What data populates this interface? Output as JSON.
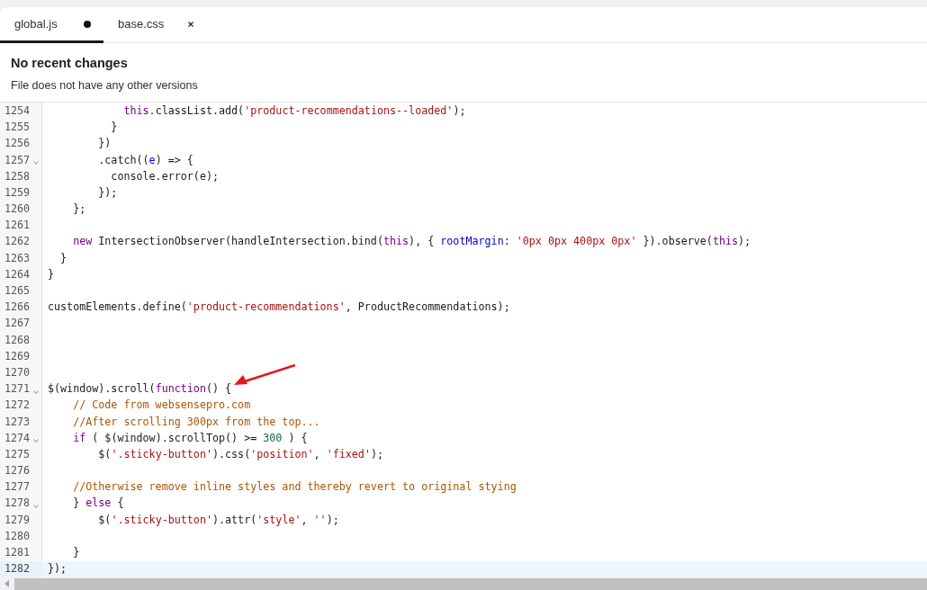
{
  "tabs": [
    {
      "label": "global.js",
      "selected": true,
      "modified": true
    },
    {
      "label": "base.css",
      "selected": false,
      "modified": false
    }
  ],
  "history": {
    "title": "No recent changes",
    "subtitle": "File does not have any other versions"
  },
  "editor": {
    "lines": [
      {
        "number": "1254",
        "fold": false,
        "active": false,
        "tokens": [
          {
            "t": "            this",
            "kind": "keyword"
          },
          {
            "t": ".classList.add(",
            "kind": "plain"
          },
          {
            "t": "'product-recommendations--loaded'",
            "kind": "string"
          },
          {
            "t": ");",
            "kind": "plain"
          }
        ]
      },
      {
        "number": "1255",
        "fold": false,
        "active": false,
        "tokens": [
          {
            "t": "          }",
            "kind": "plain"
          }
        ]
      },
      {
        "number": "1256",
        "fold": false,
        "active": false,
        "tokens": [
          {
            "t": "        })",
            "kind": "plain"
          }
        ]
      },
      {
        "number": "1257",
        "fold": true,
        "active": false,
        "tokens": [
          {
            "t": "        .catch((",
            "kind": "plain"
          },
          {
            "t": "e",
            "kind": "param"
          },
          {
            "t": ") => {",
            "kind": "plain"
          }
        ]
      },
      {
        "number": "1258",
        "fold": false,
        "active": false,
        "tokens": [
          {
            "t": "          console.error(e);",
            "kind": "plain"
          }
        ]
      },
      {
        "number": "1259",
        "fold": false,
        "active": false,
        "tokens": [
          {
            "t": "        });",
            "kind": "plain"
          }
        ]
      },
      {
        "number": "1260",
        "fold": false,
        "active": false,
        "tokens": [
          {
            "t": "    };",
            "kind": "plain"
          }
        ]
      },
      {
        "number": "1261",
        "fold": false,
        "active": false
      },
      {
        "number": "1262",
        "fold": false,
        "active": false,
        "tokens": [
          {
            "t": "    new",
            "kind": "keyword"
          },
          {
            "t": " IntersectionObserver(handleIntersection.bind(",
            "kind": "plain"
          },
          {
            "t": "this",
            "kind": "keyword"
          },
          {
            "t": "), { ",
            "kind": "plain"
          },
          {
            "t": "rootMargin",
            "kind": "property"
          },
          {
            "t": ": ",
            "kind": "plain"
          },
          {
            "t": "'0px 0px 400px 0px'",
            "kind": "string"
          },
          {
            "t": " }).observe(",
            "kind": "plain"
          },
          {
            "t": "this",
            "kind": "keyword"
          },
          {
            "t": ");",
            "kind": "plain"
          }
        ]
      },
      {
        "number": "1263",
        "fold": false,
        "active": false,
        "tokens": [
          {
            "t": "  }",
            "kind": "plain"
          }
        ]
      },
      {
        "number": "1264",
        "fold": false,
        "active": false,
        "tokens": [
          {
            "t": "}",
            "kind": "plain"
          }
        ]
      },
      {
        "number": "1265",
        "fold": false,
        "active": false
      },
      {
        "number": "1266",
        "fold": false,
        "active": false,
        "tokens": [
          {
            "t": "customElements.define(",
            "kind": "plain"
          },
          {
            "t": "'product-recommendations'",
            "kind": "string"
          },
          {
            "t": ", ProductRecommendations);",
            "kind": "plain"
          }
        ]
      },
      {
        "number": "1267",
        "fold": false,
        "active": false
      },
      {
        "number": "1268",
        "fold": false,
        "active": false
      },
      {
        "number": "1269",
        "fold": false,
        "active": false
      },
      {
        "number": "1270",
        "fold": false,
        "active": false
      },
      {
        "number": "1271",
        "fold": true,
        "active": false,
        "tokens": [
          {
            "t": "$(window).scroll(",
            "kind": "plain"
          },
          {
            "t": "function",
            "kind": "keyword"
          },
          {
            "t": "() {",
            "kind": "plain"
          }
        ]
      },
      {
        "number": "1272",
        "fold": false,
        "active": false,
        "tokens": [
          {
            "t": "    // Code from websensepro.com",
            "kind": "comment"
          }
        ]
      },
      {
        "number": "1273",
        "fold": false,
        "active": false,
        "tokens": [
          {
            "t": "    //After scrolling 300px from the top...",
            "kind": "comment"
          }
        ]
      },
      {
        "number": "1274",
        "fold": true,
        "active": false,
        "tokens": [
          {
            "t": "    if",
            "kind": "keyword"
          },
          {
            "t": " ( $(window).scrollTop() >= ",
            "kind": "plain"
          },
          {
            "t": "300",
            "kind": "number"
          },
          {
            "t": " ) {",
            "kind": "plain"
          }
        ]
      },
      {
        "number": "1275",
        "fold": false,
        "active": false,
        "tokens": [
          {
            "t": "        $(",
            "kind": "plain"
          },
          {
            "t": "'.sticky-button'",
            "kind": "string"
          },
          {
            "t": ").css(",
            "kind": "plain"
          },
          {
            "t": "'position'",
            "kind": "string"
          },
          {
            "t": ", ",
            "kind": "plain"
          },
          {
            "t": "'fixed'",
            "kind": "string"
          },
          {
            "t": ");",
            "kind": "plain"
          }
        ]
      },
      {
        "number": "1276",
        "fold": false,
        "active": false
      },
      {
        "number": "1277",
        "fold": false,
        "active": false,
        "tokens": [
          {
            "t": "    //Otherwise remove inline styles and thereby revert to original stying",
            "kind": "comment"
          }
        ]
      },
      {
        "number": "1278",
        "fold": true,
        "active": false,
        "tokens": [
          {
            "t": "    } ",
            "kind": "plain"
          },
          {
            "t": "else",
            "kind": "keyword"
          },
          {
            "t": " {",
            "kind": "plain"
          }
        ]
      },
      {
        "number": "1279",
        "fold": false,
        "active": false,
        "tokens": [
          {
            "t": "        $(",
            "kind": "plain"
          },
          {
            "t": "'.sticky-button'",
            "kind": "string"
          },
          {
            "t": ").attr(",
            "kind": "plain"
          },
          {
            "t": "'style'",
            "kind": "string"
          },
          {
            "t": ", ",
            "kind": "plain"
          },
          {
            "t": "''",
            "kind": "string"
          },
          {
            "t": ");",
            "kind": "plain"
          }
        ]
      },
      {
        "number": "1280",
        "fold": false,
        "active": false
      },
      {
        "number": "1281",
        "fold": false,
        "active": false,
        "tokens": [
          {
            "t": "    }",
            "kind": "plain"
          }
        ]
      },
      {
        "number": "1282",
        "fold": false,
        "active": true,
        "tokens": [
          {
            "t": "});",
            "kind": "plain"
          }
        ]
      }
    ]
  },
  "annotation": {
    "kind": "arrow",
    "color": "#e8141c"
  }
}
